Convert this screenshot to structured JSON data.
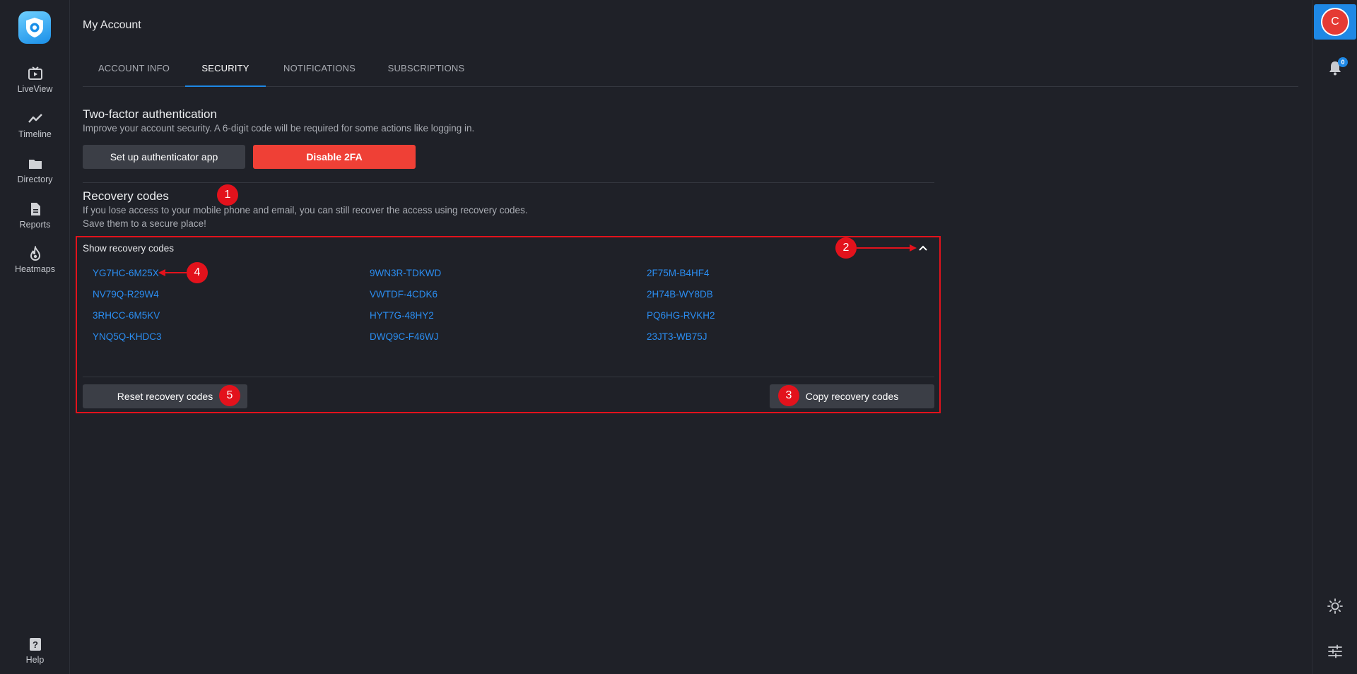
{
  "app": {
    "page_title": "My Account"
  },
  "sidebar": {
    "items": [
      {
        "label": "LiveView",
        "icon": "tv-play-icon"
      },
      {
        "label": "Timeline",
        "icon": "trend-line-icon"
      },
      {
        "label": "Directory",
        "icon": "folder-icon"
      },
      {
        "label": "Reports",
        "icon": "document-icon"
      },
      {
        "label": "Heatmaps",
        "icon": "flame-icon"
      }
    ],
    "help_label": "Help"
  },
  "tabs": [
    {
      "label": "ACCOUNT INFO",
      "active": false
    },
    {
      "label": "SECURITY",
      "active": true
    },
    {
      "label": "NOTIFICATIONS",
      "active": false
    },
    {
      "label": "SUBSCRIPTIONS",
      "active": false
    }
  ],
  "twofa": {
    "title": "Two-factor authentication",
    "description": "Improve your account security. A 6-digit code will be required for some actions like logging in.",
    "setup_button": "Set up authenticator app",
    "disable_button": "Disable 2FA"
  },
  "recovery": {
    "title": "Recovery codes",
    "description_line1": "If you lose access to your mobile phone and email, you can still recover the access using recovery codes.",
    "description_line2": "Save them to a secure place!",
    "show_label": "Show recovery codes",
    "codes": [
      "YG7HC-6M25X",
      "9WN3R-TDKWD",
      "2F75M-B4HF4",
      "NV79Q-R29W4",
      "VWTDF-4CDK6",
      "2H74B-WY8DB",
      "3RHCC-6M5KV",
      "HYT7G-48HY2",
      "PQ6HG-RVKH2",
      "YNQ5Q-KHDC3",
      "DWQ9C-F46WJ",
      "23JT3-WB75J"
    ],
    "reset_button": "Reset recovery codes",
    "copy_button": "Copy recovery codes"
  },
  "annotations": {
    "markers": [
      "1",
      "2",
      "3",
      "4",
      "5"
    ],
    "color": "#e3121c"
  },
  "rightrail": {
    "avatar_initial": "C",
    "notification_count": "0"
  },
  "colors": {
    "background": "#1f2128",
    "accent": "#1e88e5",
    "danger": "#ef4036",
    "code_link": "#2b8df0"
  }
}
